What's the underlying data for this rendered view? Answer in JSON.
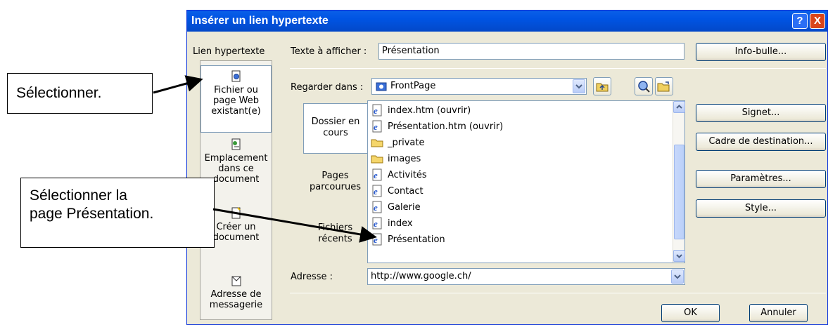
{
  "dialog": {
    "title": "Insérer un lien hypertexte",
    "help_button": "?",
    "close_button": "X"
  },
  "linkbar": {
    "header": "Lien hypertexte",
    "items": [
      {
        "line1": "Fichier ou",
        "line2": "page Web",
        "line3": "existant(e)",
        "icon": "existing-file-icon",
        "selected": true
      },
      {
        "line1": "Emplacement",
        "line2": "dans ce",
        "line3": "document",
        "icon": "place-in-document-icon",
        "selected": false
      },
      {
        "line1": "Créer un",
        "line2": "document",
        "line3": "",
        "icon": "new-document-icon",
        "selected": false
      },
      {
        "line1": "Adresse de",
        "line2": "messagerie",
        "line3": "",
        "icon": "email-address-icon",
        "selected": false
      }
    ]
  },
  "text_to_display": {
    "label": "Texte à afficher :",
    "value": "Présentation"
  },
  "look_in": {
    "label": "Regarder dans :",
    "value": "FrontPage"
  },
  "tabs": [
    {
      "line1": "Dossier en",
      "line2": "cours",
      "selected": true
    },
    {
      "line1": "Pages",
      "line2": "parcourues",
      "selected": false
    },
    {
      "line1": "Fichiers",
      "line2": "récents",
      "selected": false
    }
  ],
  "files": [
    {
      "name": "index.htm (ouvrir)",
      "icon": "web-page-icon"
    },
    {
      "name": "Présentation.htm (ouvrir)",
      "icon": "web-page-icon"
    },
    {
      "name": "_private",
      "icon": "folder-icon"
    },
    {
      "name": "images",
      "icon": "folder-icon"
    },
    {
      "name": "Activités",
      "icon": "web-page-icon"
    },
    {
      "name": "Contact",
      "icon": "web-page-icon"
    },
    {
      "name": "Galerie",
      "icon": "web-page-icon"
    },
    {
      "name": "index",
      "icon": "web-page-icon"
    },
    {
      "name": "Présentation",
      "icon": "web-page-icon"
    }
  ],
  "address": {
    "label": "Adresse :",
    "value": "http://www.google.ch/"
  },
  "buttons": {
    "info_bulle": "Info-bulle...",
    "signet": "Signet...",
    "cadre": "Cadre de destination...",
    "parametres": "Paramètres...",
    "style": "Style...",
    "ok": "OK",
    "annuler": "Annuler"
  },
  "annotations": {
    "callout1": "Sélectionner.",
    "callout2_line1": "Sélectionner la",
    "callout2_line2": "page Présentation."
  },
  "colors": {
    "title_bar": "#0054e3",
    "dialog_bg": "#ece9d8"
  }
}
